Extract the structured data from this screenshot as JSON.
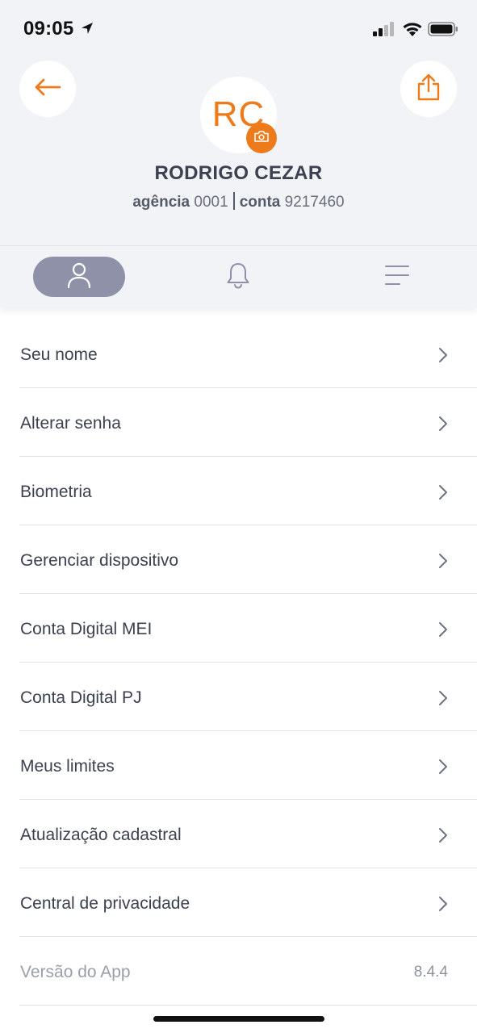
{
  "status_bar": {
    "time": "09:05"
  },
  "profile": {
    "initials": "RC",
    "name": "RODRIGO CEZAR",
    "agency_label": "agência",
    "agency_number": "0001",
    "account_label": "conta",
    "account_number": "9217460"
  },
  "icons": {
    "back": "arrow-left-icon",
    "share": "share-icon",
    "camera": "camera-icon",
    "profile_tab": "user-icon",
    "notifications_tab": "bell-icon",
    "menu_tab": "hamburger-menu-icon",
    "chevron": "chevron-right-icon"
  },
  "colors": {
    "accent": "#ee7b1b",
    "active_tab": "#8e91a8",
    "header_bg": "#f2f3f7"
  },
  "menu": {
    "items": [
      {
        "label": "Seu nome"
      },
      {
        "label": "Alterar senha"
      },
      {
        "label": "Biometria"
      },
      {
        "label": "Gerenciar dispositivo"
      },
      {
        "label": "Conta Digital MEI"
      },
      {
        "label": "Conta Digital PJ"
      },
      {
        "label": "Meus limites"
      },
      {
        "label": "Atualização cadastral"
      },
      {
        "label": "Central de privacidade"
      }
    ]
  },
  "app_version": {
    "label": "Versão do App",
    "value": "8.4.4"
  }
}
